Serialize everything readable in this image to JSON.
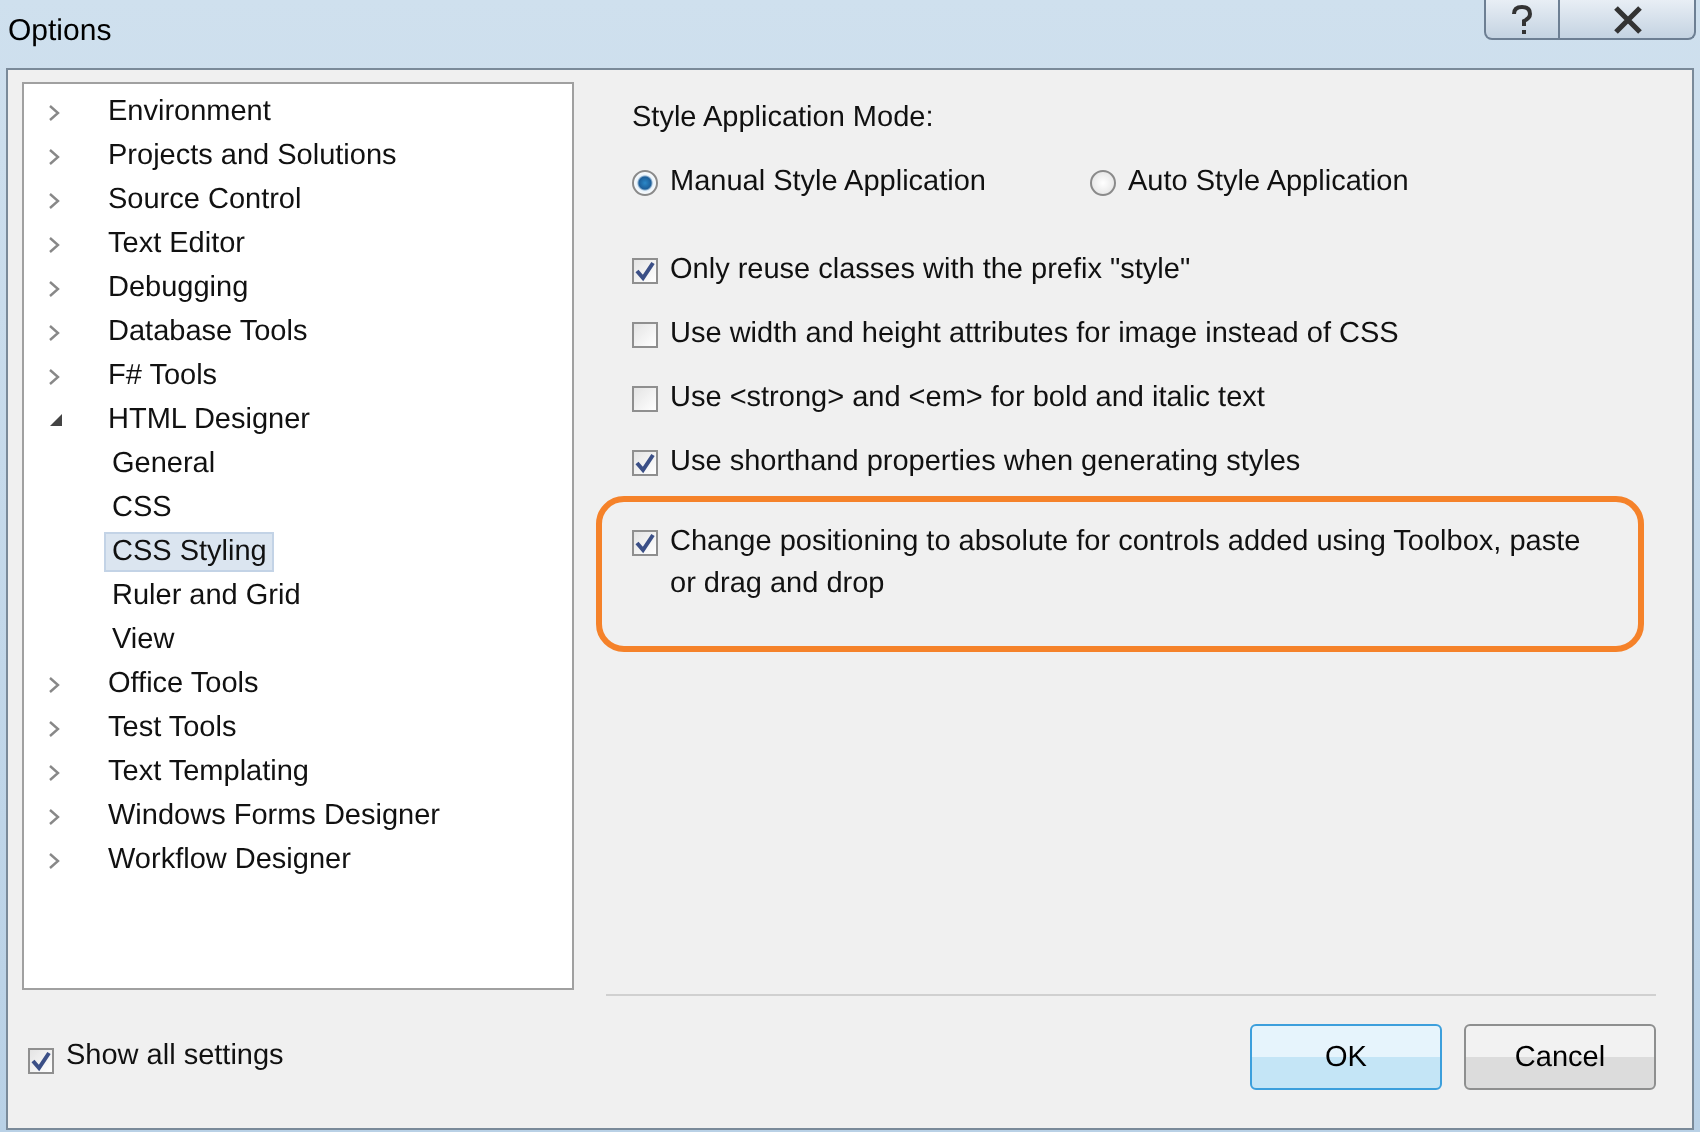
{
  "window": {
    "title": "Options"
  },
  "tree": [
    {
      "label": "Environment",
      "expanded": false,
      "selected": false
    },
    {
      "label": "Projects and Solutions",
      "expanded": false,
      "selected": false
    },
    {
      "label": "Source Control",
      "expanded": false,
      "selected": false
    },
    {
      "label": "Text Editor",
      "expanded": false,
      "selected": false
    },
    {
      "label": "Debugging",
      "expanded": false,
      "selected": false
    },
    {
      "label": "Database Tools",
      "expanded": false,
      "selected": false
    },
    {
      "label": "F# Tools",
      "expanded": false,
      "selected": false
    },
    {
      "label": "HTML Designer",
      "expanded": true,
      "selected": false,
      "children": [
        {
          "label": "General",
          "selected": false
        },
        {
          "label": "CSS",
          "selected": false
        },
        {
          "label": "CSS Styling",
          "selected": true
        },
        {
          "label": "Ruler and Grid",
          "selected": false
        },
        {
          "label": "View",
          "selected": false
        }
      ]
    },
    {
      "label": "Office Tools",
      "expanded": false,
      "selected": false
    },
    {
      "label": "Test Tools",
      "expanded": false,
      "selected": false
    },
    {
      "label": "Text Templating",
      "expanded": false,
      "selected": false
    },
    {
      "label": "Windows Forms Designer",
      "expanded": false,
      "selected": false
    },
    {
      "label": "Workflow Designer",
      "expanded": false,
      "selected": false
    }
  ],
  "mode": {
    "label": "Style Application Mode:",
    "options": [
      {
        "label": "Manual Style Application",
        "selected": true
      },
      {
        "label": "Auto Style Application",
        "selected": false
      }
    ]
  },
  "options": [
    {
      "label": "Only reuse classes with the prefix \"style\"",
      "checked": true,
      "highlighted": false
    },
    {
      "label": "Use width and height attributes for image instead of CSS",
      "checked": false,
      "highlighted": false
    },
    {
      "label": "Use <strong> and <em> for bold and italic text",
      "checked": false,
      "highlighted": false
    },
    {
      "label": "Use shorthand properties when generating styles",
      "checked": true,
      "highlighted": false
    },
    {
      "label": "Change positioning to absolute for controls added using Toolbox, paste or drag and drop",
      "checked": true,
      "highlighted": true
    }
  ],
  "show_all": {
    "label": "Show all settings",
    "checked": true
  },
  "buttons": [
    {
      "label": "OK",
      "default": true
    },
    {
      "label": "Cancel",
      "default": false
    }
  ]
}
